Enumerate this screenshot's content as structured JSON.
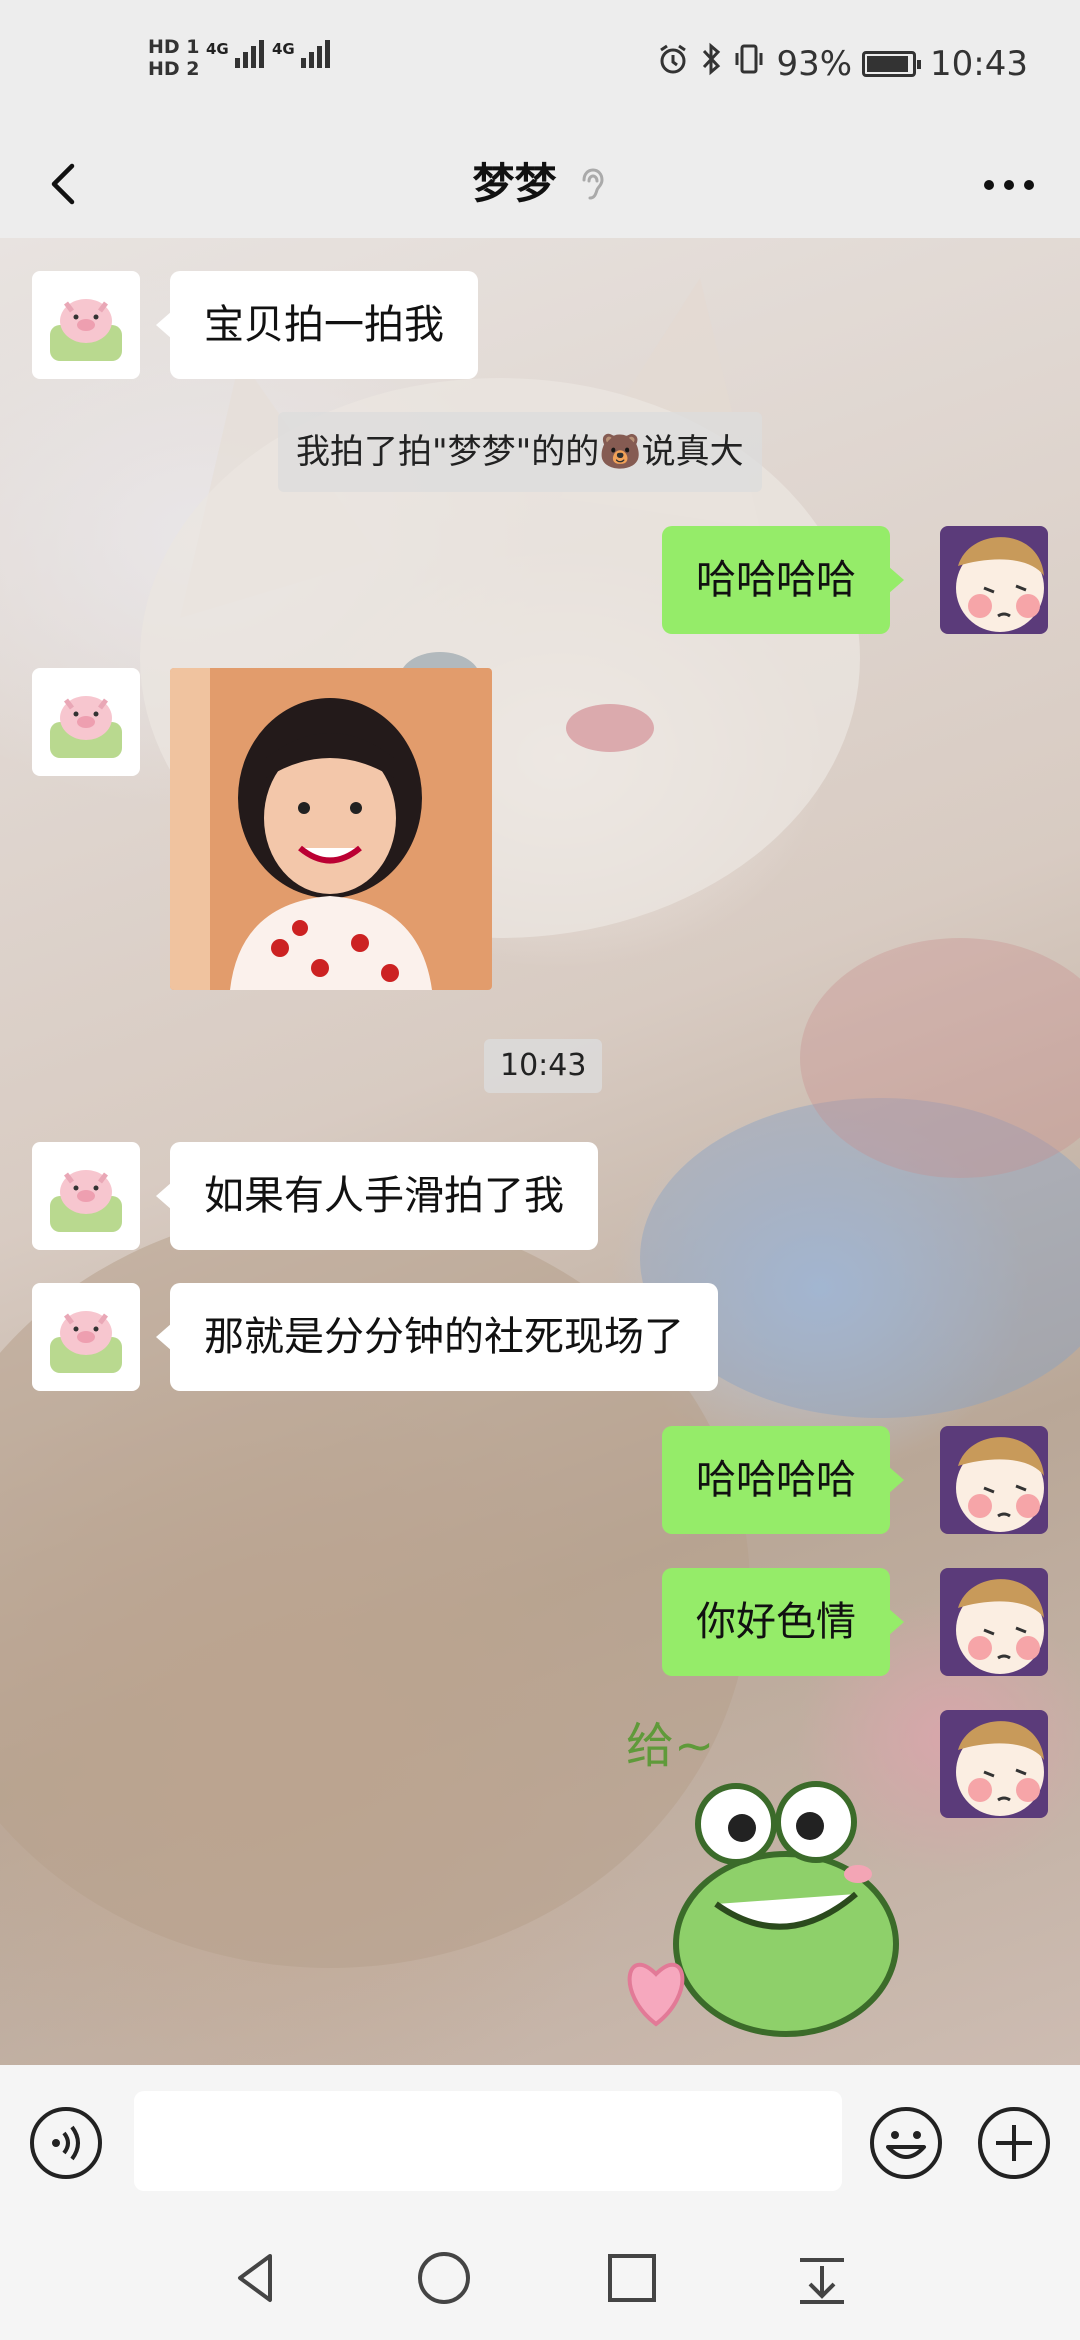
{
  "status_bar": {
    "hd1": "HD 1",
    "hd2": "HD 2",
    "network1": "4G",
    "network2": "4G",
    "battery_percent": "93%",
    "battery_level": 0.93,
    "time": "10:43",
    "icons": [
      "alarm-icon",
      "bluetooth-icon",
      "vibrate-icon",
      "battery-icon"
    ]
  },
  "header": {
    "title": "梦梦",
    "back_icon": "chevron-left-icon",
    "ear_icon": "earpiece-mode-icon",
    "more_icon": "more-dots-icon"
  },
  "messages": [
    {
      "side": "in",
      "type": "text",
      "text": "宝贝拍一拍我"
    },
    {
      "side": "system",
      "type": "pat",
      "text": "我拍了拍\"梦梦\"的的🐻说真大"
    },
    {
      "side": "out",
      "type": "text",
      "text": "哈哈哈哈"
    },
    {
      "side": "in",
      "type": "image",
      "description": "smiling-girl-photo"
    },
    {
      "side": "system",
      "type": "time",
      "text": "10:43"
    },
    {
      "side": "in",
      "type": "text",
      "text": "如果有人手滑拍了我"
    },
    {
      "side": "in",
      "type": "text",
      "text": "那就是分分钟的社死现场了"
    },
    {
      "side": "out",
      "type": "text",
      "text": "哈哈哈哈"
    },
    {
      "side": "out",
      "type": "text",
      "text": "你好色情"
    },
    {
      "side": "out",
      "type": "sticker",
      "caption": "给~"
    }
  ],
  "input_bar": {
    "placeholder": "",
    "icons": [
      "voice-icon",
      "emoji-icon",
      "plus-icon"
    ]
  },
  "system_nav": {
    "icons": [
      "back-triangle-icon",
      "home-circle-icon",
      "recents-square-icon",
      "notification-pull-icon"
    ]
  },
  "colors": {
    "outgoing_bubble": "#95ec69",
    "incoming_bubble": "#ffffff",
    "bar_background": "#ededed"
  }
}
